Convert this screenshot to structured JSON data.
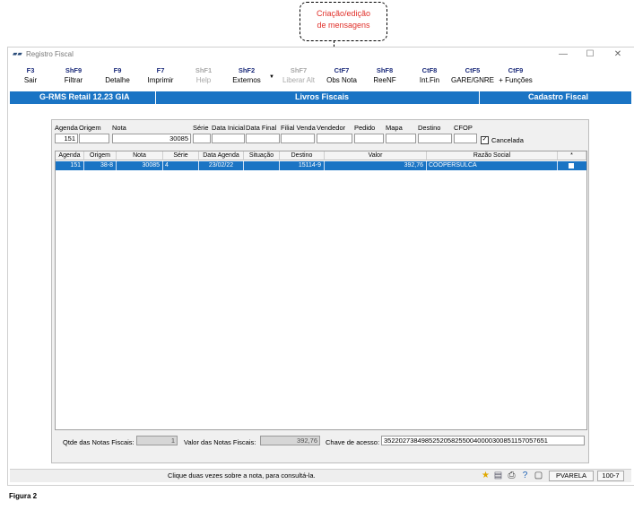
{
  "callout": {
    "text_line1": "Criação/edição",
    "text_line2": "de mensagens"
  },
  "window": {
    "title": "Registro Fiscal",
    "minimize": "—",
    "maximize": "☐",
    "close": "✕"
  },
  "toolbar": [
    {
      "key": "F3",
      "label": "Sair",
      "enabled": true
    },
    {
      "key": "ShF9",
      "label": "Filtrar",
      "enabled": true
    },
    {
      "key": "F9",
      "label": "Detalhe",
      "enabled": true
    },
    {
      "key": "F7",
      "label": "Imprimir",
      "enabled": true
    },
    {
      "key": "ShF1",
      "label": "Help",
      "enabled": false
    },
    {
      "key": "ShF2",
      "label": "Externos",
      "enabled": true
    },
    {
      "key": "ShF7",
      "label": "Liberar Alt",
      "enabled": false
    },
    {
      "key": "CtF7",
      "label": "Obs Nota",
      "enabled": true
    },
    {
      "key": "ShF8",
      "label": "ReeNF",
      "enabled": true
    },
    {
      "key": "CtF8",
      "label": "Int.Fin",
      "enabled": true
    },
    {
      "key": "CtF5",
      "label": "GARE/GNRE",
      "enabled": true
    },
    {
      "key": "CtF9",
      "label": "+ Funções",
      "enabled": true
    }
  ],
  "band": {
    "left": "G-RMS Retail 12.23 GIA",
    "center": "Livros Fiscais",
    "right": "Cadastro Fiscal"
  },
  "filters": {
    "labels": [
      "Agenda",
      "Origem",
      "Nota",
      "Série",
      "Data Inicial",
      "Data Final",
      "Filial Venda",
      "Vendedor",
      "Pedido",
      "Mapa",
      "Destino",
      "CFOP"
    ],
    "agenda": "151",
    "origem": "",
    "nota": "30085",
    "cancelada_label": "Cancelada",
    "cancelada_checked": "✓"
  },
  "grid": {
    "headers": [
      "Agenda",
      "Origem",
      "Nota",
      "Série",
      "Data Agenda",
      "Situação",
      "Destino",
      "Valor",
      "Razão Social",
      "*"
    ],
    "rows": [
      {
        "agenda": "151",
        "origem": "38-8",
        "nota": "30085",
        "serie": "4",
        "data_agenda": "23/02/22",
        "situacao": "",
        "destino": "15114-9",
        "valor": "392,76",
        "razao_social": "COOPERSULCA"
      }
    ]
  },
  "footer": {
    "qtde_label": "Qtde das Notas Fiscais:",
    "qtde_value": "1",
    "valor_label": "Valor  das Notas Fiscais:",
    "valor_value": "392,76",
    "chave_label": "Chave de acesso:",
    "chave_value": "35220273849852520582550040000300851157057651"
  },
  "status": {
    "message": "Clique duas vezes sobre a nota, para consultá-la.",
    "user": "PVARELA",
    "code": "100-7"
  },
  "caption": "Figura 2"
}
